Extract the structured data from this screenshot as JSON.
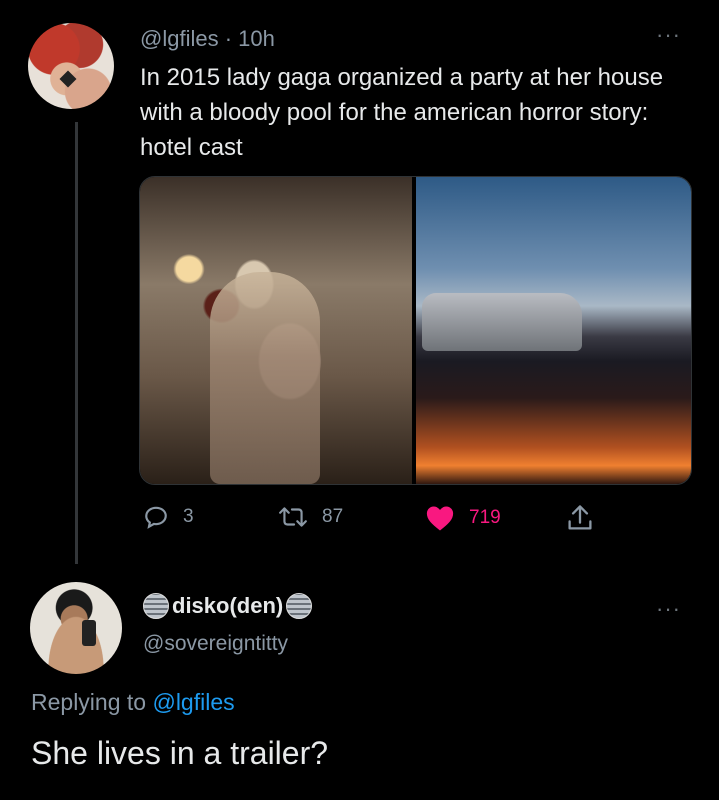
{
  "tweet": {
    "handle": "@lgfiles",
    "separator": " · ",
    "time": "10h",
    "more": "···",
    "text": "In 2015 lady gaga organized a party at her house with a bloody pool for the american horror story: hotel cast",
    "media": [
      {
        "alt": "photo-left"
      },
      {
        "alt": "photo-right"
      }
    ],
    "actions": {
      "reply_count": "3",
      "retweet_count": "87",
      "like_count": "719",
      "liked": true
    },
    "colors": {
      "like": "#f91880",
      "muted": "#8b98a5",
      "link": "#1d9bf0"
    }
  },
  "reply": {
    "display_name": "disko(den)",
    "handle": "@sovereigntitty",
    "more": "···",
    "replying_prefix": "Replying to ",
    "replying_to": "@lgfiles",
    "text": "She lives in a trailer?"
  }
}
